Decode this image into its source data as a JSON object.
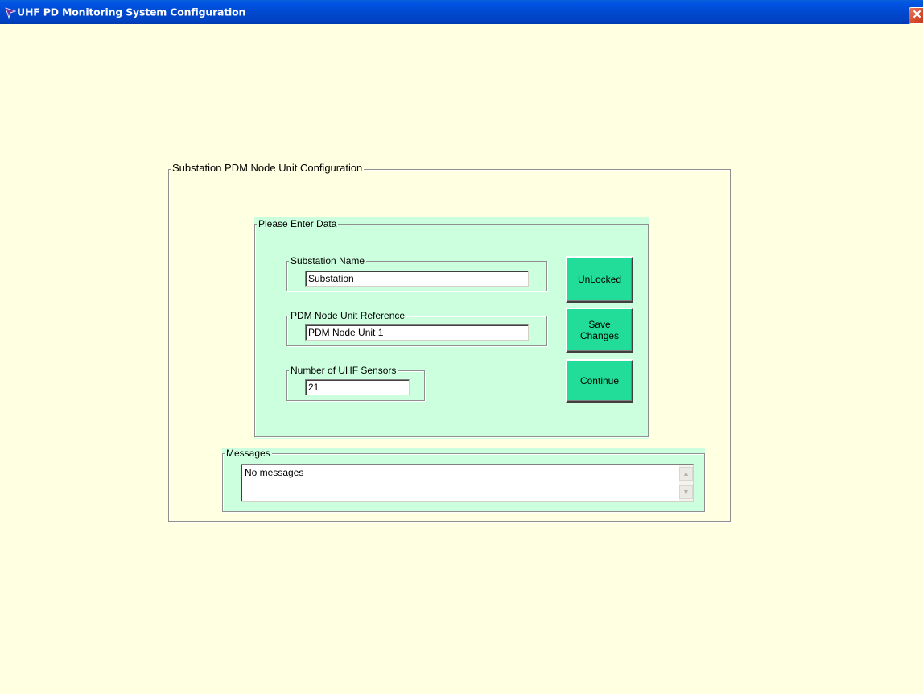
{
  "window": {
    "title": "UHF PD Monitoring System Configuration",
    "close_glyph": "✕"
  },
  "config": {
    "group_title": "Substation  PDM Node Unit Configuration",
    "data_panel_title": "Please Enter Data",
    "substation_name": {
      "label": "Substation Name",
      "value": "Substation"
    },
    "pdm_node_ref": {
      "label": "PDM Node Unit Reference",
      "value": "PDM Node Unit 1"
    },
    "num_sensors": {
      "label": "Number of UHF Sensors",
      "value": "21"
    },
    "buttons": {
      "unlocked": "UnLocked",
      "save": "Save Changes",
      "continue": "Continue"
    }
  },
  "messages": {
    "title": "Messages",
    "text": "No messages",
    "scroll_up_glyph": "▲",
    "scroll_down_glyph": "▼"
  },
  "colors": {
    "background": "#ffffe1",
    "panel": "#ccffdd",
    "button": "#22dd99",
    "titlebar": "#0054e3"
  }
}
